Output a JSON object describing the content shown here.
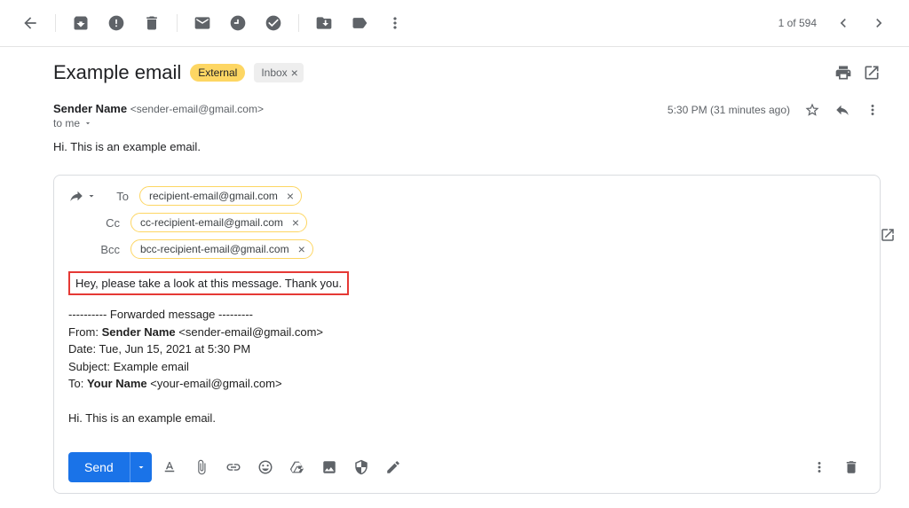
{
  "toolbar": {
    "count_text": "1 of 594"
  },
  "subject": "Example email",
  "chips": {
    "external": "External",
    "inbox": "Inbox"
  },
  "sender": {
    "name": "Sender Name",
    "email": "<sender-email@gmail.com>"
  },
  "to_line": "to me",
  "timestamp": "5:30 PM (31 minutes ago)",
  "body": "Hi. This is an example email.",
  "compose": {
    "labels": {
      "to": "To",
      "cc": "Cc",
      "bcc": "Bcc"
    },
    "to": "recipient-email@gmail.com",
    "cc": "cc-recipient-email@gmail.com",
    "bcc": "bcc-recipient-email@gmail.com",
    "note": "Hey, please take a look at this message. Thank you.",
    "send": "Send",
    "forwarded": {
      "header": "---------- Forwarded message ---------",
      "from_label": "From: ",
      "from_name": "Sender Name",
      "from_email": " <sender-email@gmail.com>",
      "date_line": "Date: Tue, Jun 15, 2021 at 5:30 PM",
      "subject_line": "Subject: Example email",
      "to_label": "To: ",
      "to_name": "Your Name",
      "to_email": " <your-email@gmail.com>",
      "body": "Hi. This is an example email."
    }
  }
}
